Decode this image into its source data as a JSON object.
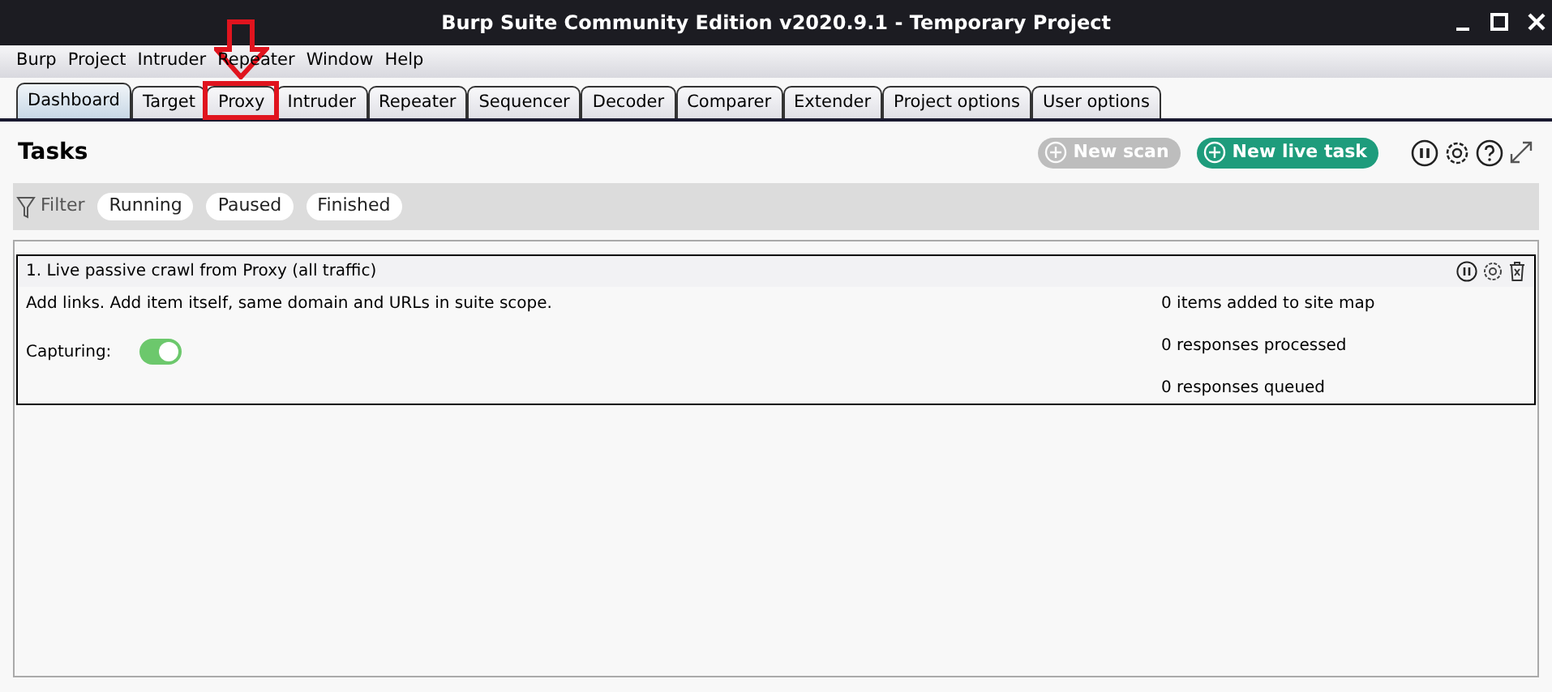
{
  "window": {
    "title": "Burp Suite Community Edition v2020.9.1 - Temporary Project"
  },
  "menu": [
    "Burp",
    "Project",
    "Intruder",
    "Repeater",
    "Window",
    "Help"
  ],
  "tabs": [
    {
      "label": "Dashboard",
      "selected": true
    },
    {
      "label": "Target",
      "selected": false
    },
    {
      "label": "Proxy",
      "selected": false,
      "highlighted": true
    },
    {
      "label": "Intruder",
      "selected": false
    },
    {
      "label": "Repeater",
      "selected": false
    },
    {
      "label": "Sequencer",
      "selected": false
    },
    {
      "label": "Decoder",
      "selected": false
    },
    {
      "label": "Comparer",
      "selected": false
    },
    {
      "label": "Extender",
      "selected": false
    },
    {
      "label": "Project options",
      "selected": false
    },
    {
      "label": "User options",
      "selected": false
    }
  ],
  "tasks": {
    "heading": "Tasks",
    "new_scan": {
      "label": "New scan",
      "disabled": true
    },
    "new_live_task": {
      "label": "New live task",
      "disabled": false
    },
    "filter": {
      "label": "Filter",
      "chips": [
        "Running",
        "Paused",
        "Finished"
      ]
    },
    "items": [
      {
        "title": "1. Live passive crawl from Proxy (all traffic)",
        "description": "Add links. Add item itself, same domain and URLs in suite scope.",
        "capturing_label": "Capturing:",
        "capturing": true,
        "stats": [
          "0 items added to site map",
          "0 responses processed",
          "0 responses queued"
        ]
      }
    ]
  }
}
